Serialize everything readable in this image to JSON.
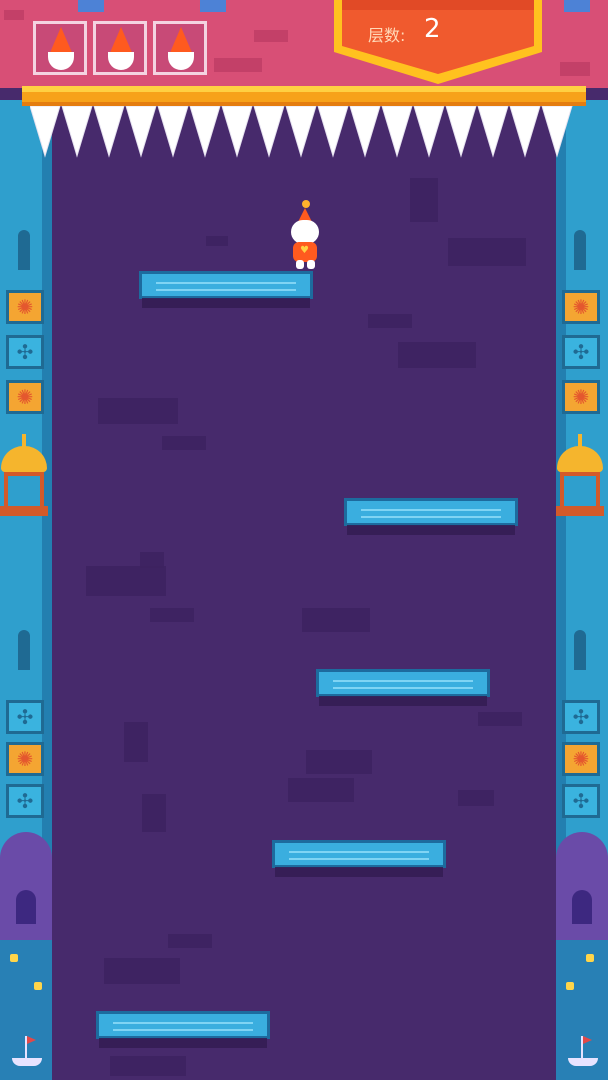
{
  "hud": {
    "floor_label": "层数:",
    "floor_value": "2",
    "lives": [
      {
        "icon": "gnome-life-icon"
      },
      {
        "icon": "gnome-life-icon"
      },
      {
        "icon": "gnome-life-icon"
      }
    ]
  },
  "colors": {
    "background": "#472a6c",
    "top_bar": "#d84f76",
    "badge": "#f05a2e",
    "badge_border": "#ffc21f",
    "platform": "#3aaedf",
    "wall": "#2f9fcd",
    "player_hat": "#ff5a1f"
  },
  "icons": {
    "player": "gnome-player-icon",
    "spikes": "ceiling-spikes-icon",
    "life": "gnome-life-icon"
  }
}
